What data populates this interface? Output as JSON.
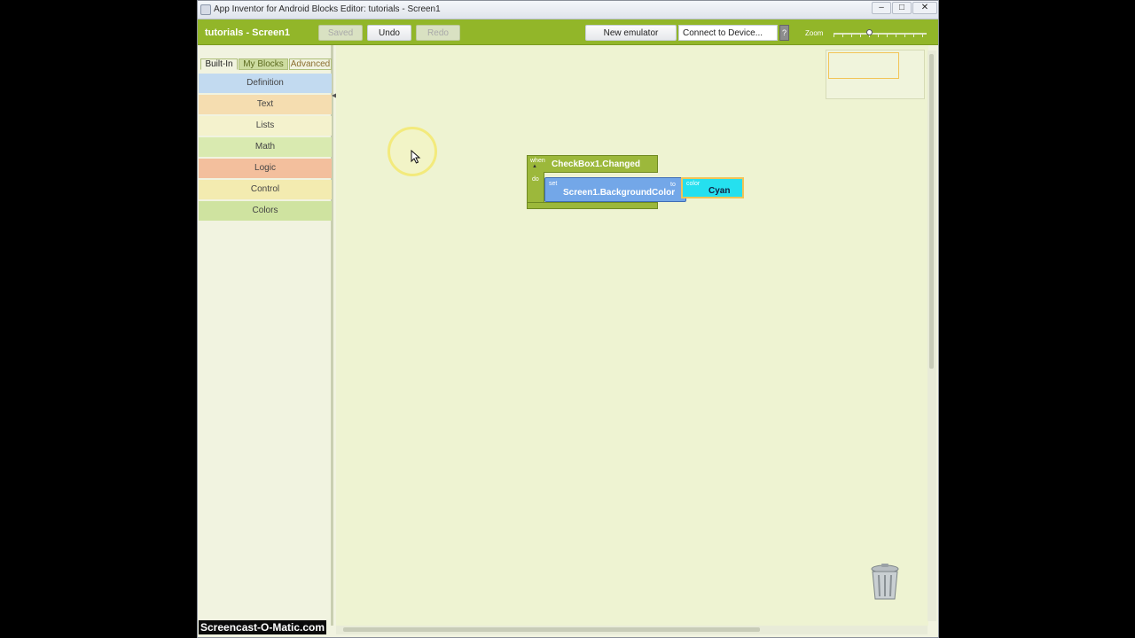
{
  "window": {
    "title": "App Inventor for Android Blocks Editor: tutorials - Screen1",
    "minimize": "–",
    "maximize": "□",
    "close": "✕"
  },
  "toolbar": {
    "project": "tutorials - Screen1",
    "saved_label": "Saved",
    "undo_label": "Undo",
    "redo_label": "Redo",
    "new_emulator_label": "New emulator",
    "connect_label": "Connect to Device...",
    "help_label": "?",
    "zoom_label": "Zoom"
  },
  "palette": {
    "tabs": [
      "Built-In",
      "My Blocks",
      "Advanced"
    ],
    "categories": [
      {
        "label": "Definition",
        "color": "#c2daf0"
      },
      {
        "label": "Text",
        "color": "#f5ddb0"
      },
      {
        "label": "Lists",
        "color": "#f4f2cd"
      },
      {
        "label": "Math",
        "color": "#d9eab0"
      },
      {
        "label": "Logic",
        "color": "#f3bf9d"
      },
      {
        "label": "Control",
        "color": "#f3ebb0"
      },
      {
        "label": "Colors",
        "color": "#cfe3a0"
      }
    ]
  },
  "blocks": {
    "event": {
      "when": "when",
      "do": "do",
      "name": "CheckBox1.Changed"
    },
    "setter": {
      "set": "set",
      "property": "Screen1.BackgroundColor",
      "to": "to"
    },
    "color": {
      "label": "color",
      "value": "Cyan"
    }
  },
  "icons": [
    "java-icon",
    "cursor-icon",
    "trash-icon"
  ],
  "watermark": "Screencast-O-Matic.com"
}
